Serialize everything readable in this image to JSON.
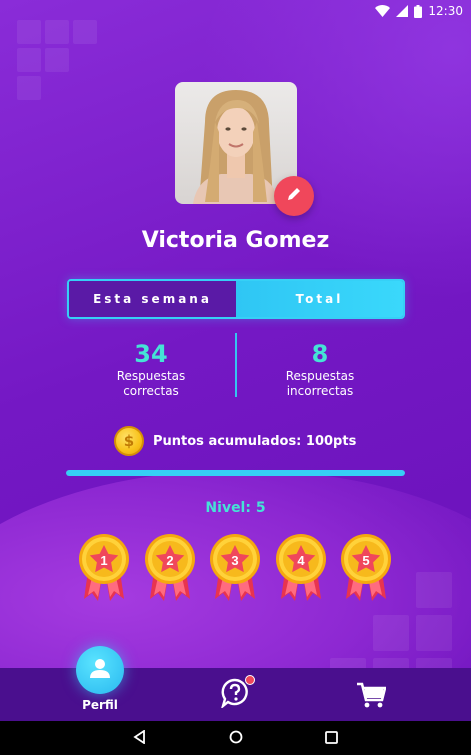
{
  "status_bar": {
    "time": "12:30"
  },
  "profile": {
    "name": "Victoria Gomez"
  },
  "tabs": [
    {
      "label": "Esta semana",
      "active": false
    },
    {
      "label": "Total",
      "active": true
    }
  ],
  "stats": {
    "correct": {
      "value": "34",
      "label_line1": "Respuestas",
      "label_line2": "correctas"
    },
    "incorrect": {
      "value": "8",
      "label_line1": "Respuestas",
      "label_line2": "incorrectas"
    }
  },
  "points": {
    "text": "Puntos acumulados: 100pts",
    "icon": "coin-icon"
  },
  "progress": {
    "fraction": 1.0
  },
  "level": {
    "text": "Nivel: 5"
  },
  "medals": [
    "1",
    "2",
    "3",
    "4",
    "5"
  ],
  "bottom_nav": {
    "profile_label": "Perfil",
    "items": [
      "user-icon",
      "help-icon",
      "cart-icon"
    ]
  },
  "colors": {
    "accent_cyan": "#36cff5",
    "accent_teal": "#45e3d6",
    "edit_red": "#f0475b",
    "background_purple": "#7418c4",
    "nav_purple": "#4a0f8e"
  }
}
